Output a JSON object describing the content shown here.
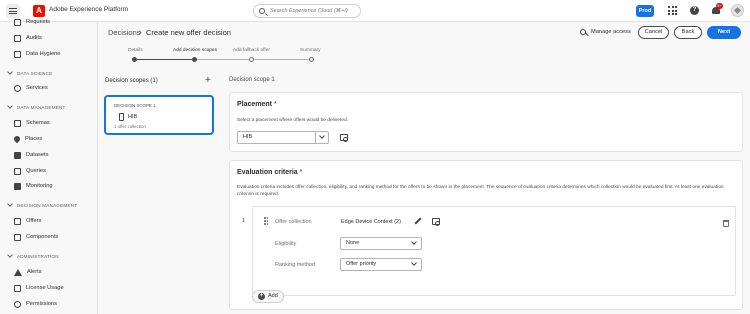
{
  "header": {
    "app_title": "Adobe Experience Platform",
    "search_placeholder": "Search Experience Cloud (⌘+/)",
    "env_badge": "Prod",
    "notification_count": "9+"
  },
  "sidebar": {
    "items_top": [
      {
        "label": "Requests",
        "icon": "requests-icon"
      },
      {
        "label": "Audits",
        "icon": "audits-icon"
      },
      {
        "label": "Data Hygiene",
        "icon": "data-hygiene-icon"
      }
    ],
    "sections": [
      {
        "title": "DATA SCIENCE",
        "items": [
          {
            "label": "Services",
            "icon": "services-icon"
          }
        ]
      },
      {
        "title": "DATA MANAGEMENT",
        "items": [
          {
            "label": "Schemas",
            "icon": "schemas-icon"
          },
          {
            "label": "Places",
            "icon": "places-icon"
          },
          {
            "label": "Datasets",
            "icon": "datasets-icon"
          },
          {
            "label": "Queries",
            "icon": "queries-icon"
          },
          {
            "label": "Monitoring",
            "icon": "monitoring-icon"
          }
        ]
      },
      {
        "title": "DECISION MANAGEMENT",
        "items": [
          {
            "label": "Offers",
            "icon": "offers-icon"
          },
          {
            "label": "Components",
            "icon": "components-icon"
          }
        ]
      },
      {
        "title": "ADMINISTRATION",
        "items": [
          {
            "label": "Alerts",
            "icon": "alerts-icon"
          },
          {
            "label": "License Usage",
            "icon": "license-usage-icon"
          },
          {
            "label": "Permissions",
            "icon": "permissions-icon"
          }
        ]
      }
    ]
  },
  "page": {
    "breadcrumb": "Decisions",
    "title": "Create new offer decision",
    "actions": {
      "manage_access": "Manage access",
      "cancel": "Cancel",
      "back": "Back",
      "next": "Next"
    },
    "steps": [
      {
        "label": "Details",
        "state": "done"
      },
      {
        "label": "Add decision scopes",
        "state": "active"
      },
      {
        "label": "Add fallback offer",
        "state": "pending"
      },
      {
        "label": "Summary",
        "state": "pending"
      }
    ]
  },
  "scopes": {
    "heading": "Decision scopes (1)",
    "add_symbol": "+",
    "card": {
      "tag": "DECISION SCOPE 1",
      "name": "HIB",
      "sub": "1 offer collection"
    }
  },
  "detail": {
    "scope_title": "Decision scope 1",
    "placement": {
      "title": "Placement",
      "required_mark": "*",
      "description": "Select a placement where offers would be delivered.",
      "value": "HIB"
    },
    "evaluation": {
      "title": "Evaluation criteria",
      "required_mark": "*",
      "description": "Evaluation criteria includes offer collection, eligibility, and ranking method for the offers to be shown in the placement. The sequence of evaluation criteria determines which collection would be evaluated first. At least one evaluation criterion is required.",
      "rank": "1",
      "offer_collection_label": "Offer collection",
      "offer_collection_value": "Edge Device Context (2)",
      "eligibility_label": "Eligibility",
      "eligibility_value": "None",
      "ranking_label": "Ranking method",
      "ranking_value": "Offer priority",
      "add_label": "Add"
    }
  }
}
